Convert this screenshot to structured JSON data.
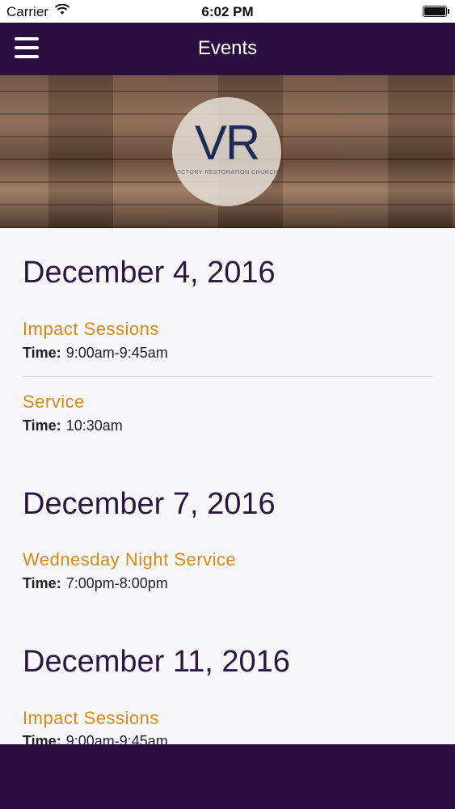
{
  "status": {
    "carrier": "Carrier",
    "time": "6:02 PM"
  },
  "nav": {
    "title": "Events"
  },
  "banner": {
    "logo": "VR",
    "subtitle": "VICTORY RESTORATION CHURCH"
  },
  "events": [
    {
      "date": "December 4, 2016",
      "items": [
        {
          "title": "Impact Sessions",
          "time_label": "Time:",
          "time": "9:00am-9:45am"
        },
        {
          "title": "Service",
          "time_label": "Time:",
          "time": "10:30am"
        }
      ]
    },
    {
      "date": "December 7, 2016",
      "items": [
        {
          "title": "Wednesday Night Service",
          "time_label": "Time:",
          "time": "7:00pm-8:00pm"
        }
      ]
    },
    {
      "date": "December 11, 2016",
      "items": [
        {
          "title": "Impact Sessions",
          "time_label": "Time:",
          "time": "9:00am-9:45am"
        }
      ]
    }
  ],
  "colors": {
    "nav": "#2a0e3f",
    "accent": "#d48a1a",
    "date": "#2a1640"
  }
}
